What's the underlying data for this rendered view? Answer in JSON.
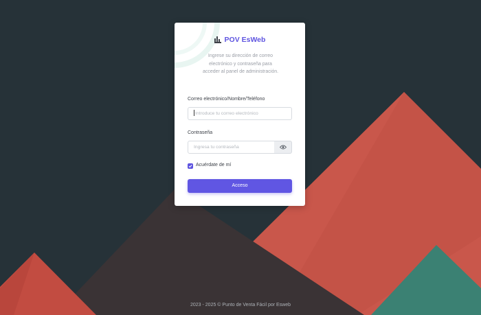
{
  "brand": {
    "title": "POV EsWeb",
    "icon": "factory-icon",
    "color": "#5e54e0"
  },
  "subtitle": "Ingrese su dirección de correo electrónico y contraseña para acceder al panel de administración.",
  "form": {
    "email_label": "Correo electrónico/Nombre/Teléfono",
    "email_placeholder": "Introduce tu correo electrónico",
    "password_label": "Contraseña",
    "password_placeholder": "Ingresa tu contraseña",
    "password_toggle_icon": "eye-icon",
    "remember_label": "Acuérdate de mí",
    "remember_checked": true,
    "submit_label": "Acceso"
  },
  "footer": "2023 - 2025 © Punto de Venta Fácil por Esweb",
  "colors": {
    "background": "#263238",
    "accent": "#6056e3",
    "triangle_red": "#c9574b",
    "triangle_dark": "#3a3335",
    "triangle_teal": "#3b8173"
  }
}
